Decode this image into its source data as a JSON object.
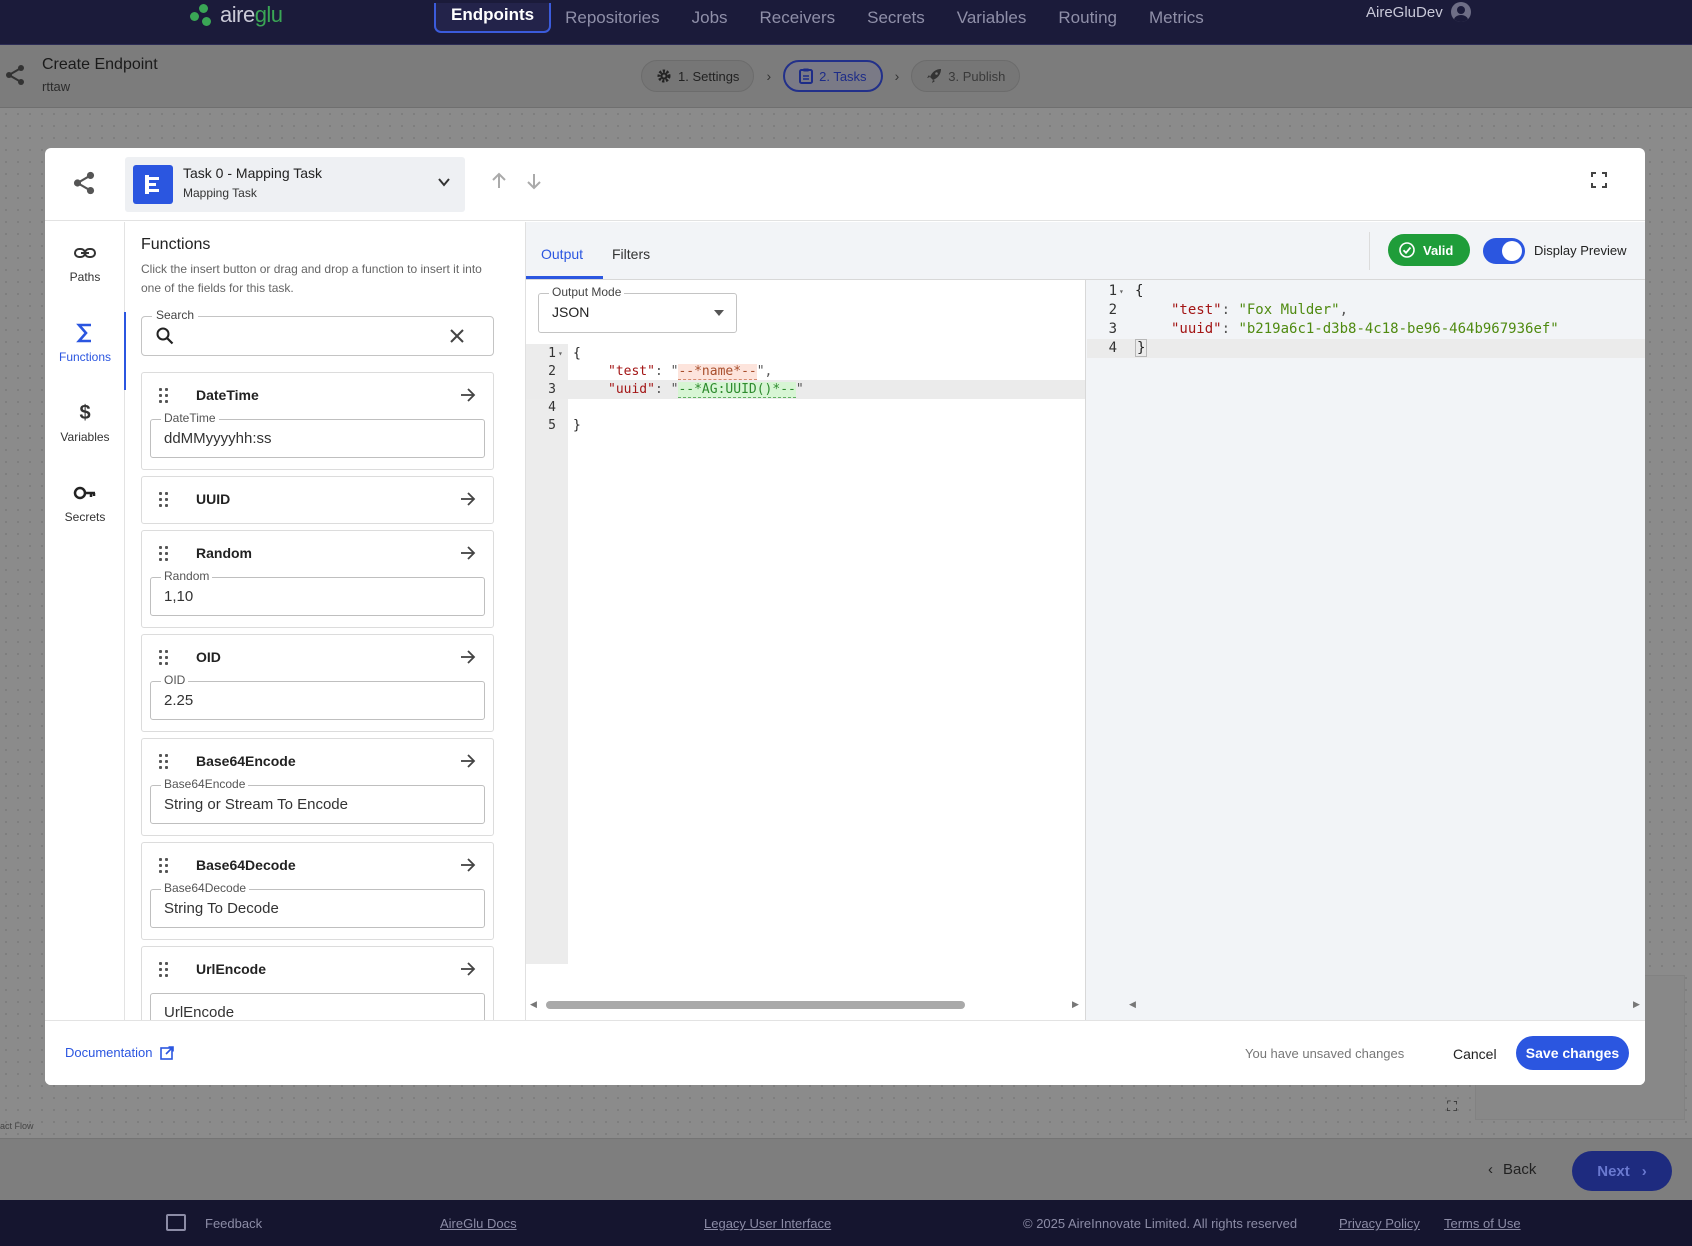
{
  "brand": {
    "name_prefix": "aire",
    "name_suffix": "glu"
  },
  "nav": {
    "items": [
      "Endpoints",
      "Repositories",
      "Jobs",
      "Receivers",
      "Secrets",
      "Variables",
      "Routing",
      "Metrics"
    ],
    "active": "Endpoints",
    "user": "AireGluDev"
  },
  "header": {
    "title": "Create Endpoint",
    "subtitle": "rttaw"
  },
  "steps": [
    {
      "label": "1. Settings",
      "icon": "gear-icon"
    },
    {
      "label": "2. Tasks",
      "icon": "clipboard-icon"
    },
    {
      "label": "3. Publish",
      "icon": "rocket-icon"
    }
  ],
  "modal": {
    "task": {
      "name": "Task 0 - Mapping Task",
      "type": "Mapping Task"
    },
    "side_nav": [
      {
        "label": "Paths",
        "icon": "link-icon"
      },
      {
        "label": "Functions",
        "icon": "sigma-icon"
      },
      {
        "label": "Variables",
        "icon": "dollar-icon"
      },
      {
        "label": "Secrets",
        "icon": "key-icon"
      }
    ],
    "functions": {
      "title": "Functions",
      "description": "Click the insert button or drag and drop a function to insert it into one of the fields for this task.",
      "search_label": "Search",
      "search_value": "",
      "items": [
        {
          "name": "DateTime",
          "field_label": "DateTime",
          "field_value": "ddMMyyyyhh:ss"
        },
        {
          "name": "UUID"
        },
        {
          "name": "Random",
          "field_label": "Random",
          "field_value": "1,10"
        },
        {
          "name": "OID",
          "field_label": "OID",
          "field_value": "2.25"
        },
        {
          "name": "Base64Encode",
          "field_label": "Base64Encode",
          "field_value": "String or Stream To Encode"
        },
        {
          "name": "Base64Decode",
          "field_label": "Base64Decode",
          "field_value": "String To Decode"
        },
        {
          "name": "UrlEncode",
          "field_label": "",
          "field_value": "UrlEncode"
        }
      ]
    },
    "tabs": [
      "Output",
      "Filters"
    ],
    "active_tab": "Output",
    "valid_label": "Valid",
    "preview_label": "Display Preview",
    "preview_on": true,
    "output_mode": {
      "label": "Output Mode",
      "value": "JSON"
    },
    "editor_lines": [
      {
        "n": "1",
        "code": "{"
      },
      {
        "n": "2",
        "key": "\"test\"",
        "sep": ": \"",
        "tok": "--*name*--",
        "end": "\","
      },
      {
        "n": "3",
        "key": "\"uuid\"",
        "sep": ": \"",
        "tok": "--*AG:UUID()*--",
        "end": "\""
      },
      {
        "n": "4",
        "code": ""
      },
      {
        "n": "5",
        "code": "}"
      }
    ],
    "preview_lines": [
      {
        "n": "1",
        "code": "{"
      },
      {
        "n": "2",
        "key": "\"test\"",
        "val": "\"Fox Mulder\"",
        "end": ","
      },
      {
        "n": "3",
        "key": "\"uuid\"",
        "val": "\"b219a6c1-d3b8-4c18-be96-464b967936ef\"",
        "end": ""
      },
      {
        "n": "4",
        "code": "}"
      }
    ],
    "footer": {
      "documentation": "Documentation",
      "unsaved": "You have unsaved changes",
      "cancel": "Cancel",
      "save": "Save changes"
    }
  },
  "canvas": {
    "label": "act Flow"
  },
  "actions": {
    "back": "Back",
    "next": "Next"
  },
  "footer": {
    "feedback": "Feedback",
    "docs": "AireGlu Docs",
    "legacy": "Legacy User Interface",
    "copyright": "© 2025 AireInnovate Limited. All rights reserved",
    "privacy": "Privacy Policy",
    "terms": "Terms of Use"
  },
  "colors": {
    "accent": "#2b56e0",
    "valid": "#1f9d3a",
    "nav_bg": "#1b1b3a"
  }
}
